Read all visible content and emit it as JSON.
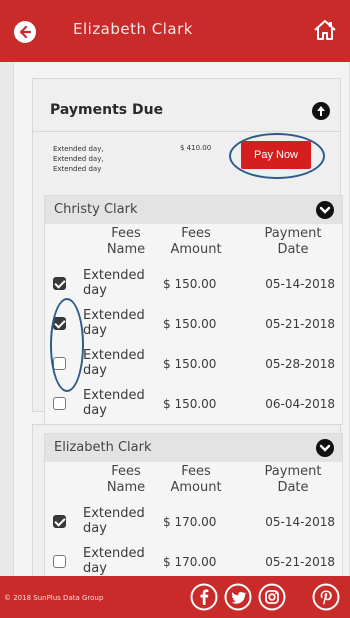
{
  "header": {
    "title": "Elizabeth Clark"
  },
  "payments_due": {
    "title": "Payments Due",
    "lines": [
      "Extended day,",
      "Extended day,",
      "Extended day"
    ],
    "amount": "$ 410.00",
    "pay_button": "Pay Now"
  },
  "students": [
    {
      "name": "Christy Clark",
      "columns": {
        "name": "Fees\nName",
        "amount": "Fees\nAmount",
        "date": "Payment\nDate"
      },
      "rows": [
        {
          "checked": true,
          "name": "Extended\nday",
          "amount": "$ 150.00",
          "date": "05-14-2018"
        },
        {
          "checked": true,
          "name": "Extended\nday",
          "amount": "$ 150.00",
          "date": "05-21-2018"
        },
        {
          "checked": false,
          "name": "Extended\nday",
          "amount": "$ 150.00",
          "date": "05-28-2018"
        },
        {
          "checked": false,
          "name": "Extended\nday",
          "amount": "$ 150.00",
          "date": "06-04-2018"
        }
      ]
    },
    {
      "name": "Elizabeth Clark",
      "columns": {
        "name": "Fees\nName",
        "amount": "Fees\nAmount",
        "date": "Payment\nDate"
      },
      "rows": [
        {
          "checked": true,
          "name": "Extended\nday",
          "amount": "$ 170.00",
          "date": "05-14-2018"
        },
        {
          "checked": false,
          "name": "Extended\nday",
          "amount": "$ 170.00",
          "date": "05-21-2018"
        }
      ]
    }
  ],
  "footer": {
    "copyright": "© 2018 SunPlus Data Group",
    "social_icons": [
      "facebook-icon",
      "twitter-icon",
      "instagram-icon",
      "pinterest-icon"
    ]
  },
  "colors": {
    "brand_red": "#c92a2a",
    "button_red": "#d51f1f",
    "highlight_ring": "#2f5a8a"
  }
}
